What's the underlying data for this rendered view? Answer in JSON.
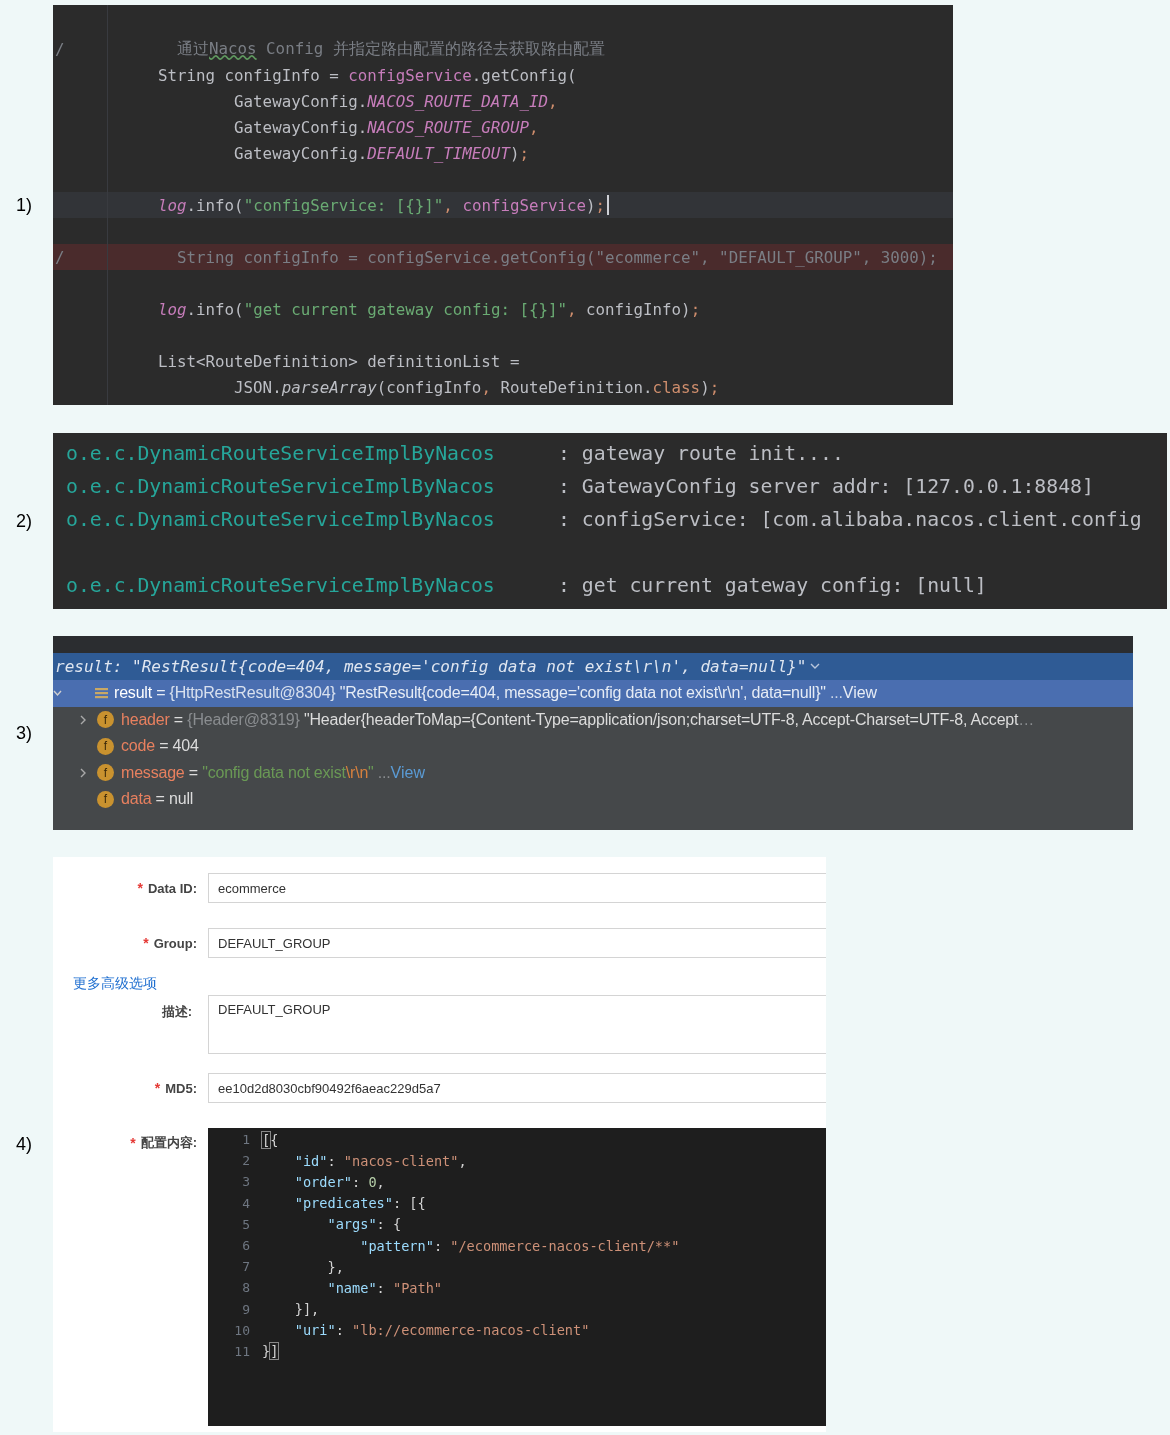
{
  "code": {
    "label": "1)",
    "lines": [
      {
        "kind": "code",
        "gutter": "/",
        "tokens": [
          {
            "kind": "comment",
            "text": "  通过"
          },
          {
            "kind": "typo",
            "text": "Nacos"
          },
          {
            "kind": "comment",
            "text": " Config 并指定路由配置的路径去获取路由配置"
          }
        ]
      },
      {
        "kind": "code",
        "tokens": [
          {
            "kind": "plain",
            "text": "String configInfo = "
          },
          {
            "kind": "field",
            "text": "configService"
          },
          {
            "kind": "plain",
            "text": ".getConfig("
          }
        ]
      },
      {
        "kind": "code",
        "tokens": [
          {
            "kind": "plain",
            "text": "        GatewayConfig."
          },
          {
            "kind": "constant",
            "text": "NACOS_ROUTE_DATA_ID"
          },
          {
            "kind": "punct",
            "text": ","
          }
        ]
      },
      {
        "kind": "code",
        "tokens": [
          {
            "kind": "plain",
            "text": "        GatewayConfig."
          },
          {
            "kind": "constant",
            "text": "NACOS_ROUTE_GROUP"
          },
          {
            "kind": "punct",
            "text": ","
          }
        ]
      },
      {
        "kind": "code",
        "tokens": [
          {
            "kind": "plain",
            "text": "        GatewayConfig."
          },
          {
            "kind": "constant",
            "text": "DEFAULT_TIMEOUT"
          },
          {
            "kind": "plain",
            "text": ")"
          },
          {
            "kind": "punct",
            "text": ";"
          }
        ]
      },
      {
        "kind": "blank"
      },
      {
        "kind": "current",
        "tokens": [
          {
            "kind": "static",
            "text": "log"
          },
          {
            "kind": "plain",
            "text": ".info("
          },
          {
            "kind": "string",
            "text": "\"configService: [{}]\""
          },
          {
            "kind": "punct",
            "text": ", "
          },
          {
            "kind": "field",
            "text": "configService"
          },
          {
            "kind": "plain",
            "text": ")"
          },
          {
            "kind": "punct",
            "text": ";"
          }
        ]
      },
      {
        "kind": "blank"
      },
      {
        "kind": "error",
        "gutter": "/",
        "tokens": [
          {
            "kind": "comment",
            "text": "  String configInfo = configService.getConfig(\"ecommerce\", \"DEFAULT_GROUP\", 3000);"
          }
        ]
      },
      {
        "kind": "blank"
      },
      {
        "kind": "code",
        "tokens": [
          {
            "kind": "static",
            "text": "log"
          },
          {
            "kind": "plain",
            "text": ".info("
          },
          {
            "kind": "string",
            "text": "\"get current gateway config: [{}]\""
          },
          {
            "kind": "punct",
            "text": ", "
          },
          {
            "kind": "plain",
            "text": "configInfo)"
          },
          {
            "kind": "punct",
            "text": ";"
          }
        ]
      },
      {
        "kind": "blank"
      },
      {
        "kind": "code",
        "tokens": [
          {
            "kind": "plain",
            "text": "List<RouteDefinition> definitionList ="
          }
        ]
      },
      {
        "kind": "code",
        "tokens": [
          {
            "kind": "plain",
            "text": "        JSON."
          },
          {
            "kind": "italic",
            "text": "parseArray"
          },
          {
            "kind": "plain",
            "text": "(configInfo"
          },
          {
            "kind": "punct",
            "text": ", "
          },
          {
            "kind": "plain",
            "text": "RouteDefinition."
          },
          {
            "kind": "punct",
            "text": "class"
          },
          {
            "kind": "plain",
            "text": ")"
          },
          {
            "kind": "punct",
            "text": ";"
          }
        ]
      }
    ]
  },
  "console": {
    "label": "2)",
    "lines": [
      {
        "kind": "log",
        "logger": "o.e.c.DynamicRouteServiceImplByNacos",
        "message": ": gateway route init...."
      },
      {
        "kind": "log",
        "logger": "o.e.c.DynamicRouteServiceImplByNacos",
        "message": ": GatewayConfig server addr: [127.0.0.1:8848]"
      },
      {
        "kind": "log",
        "logger": "o.e.c.DynamicRouteServiceImplByNacos",
        "message": ": configService: [com.alibaba.nacos.client.config"
      },
      {
        "kind": "blank"
      },
      {
        "kind": "log",
        "logger": "o.e.c.DynamicRouteServiceImplByNacos",
        "message": ": get current gateway config: [null]"
      }
    ]
  },
  "debugger": {
    "label": "3)",
    "eval": "result: \"RestResult{code=404, message='config data not exist\\r\\n', data=null}\"",
    "tree": [
      {
        "kind": "list",
        "selected": true,
        "expanded": true,
        "tokens": [
          {
            "kind": "name",
            "text": "result"
          },
          {
            "kind": "plain",
            "text": " = "
          },
          {
            "kind": "ref",
            "text": "{HttpRestResult@8304}"
          },
          {
            "kind": "plain",
            "text": " \"RestResult{code=404, message='config data not exist\\r\\n', data=null}\""
          },
          {
            "kind": "dim",
            "text": " ..."
          }
        ],
        "link": "View",
        "children": [
          {
            "kind": "field",
            "badge": "f",
            "selected": false,
            "expanded": false,
            "tokens": [
              {
                "kind": "name",
                "text": "header"
              },
              {
                "kind": "plain",
                "text": " = "
              },
              {
                "kind": "ref",
                "text": "{Header@8319}"
              },
              {
                "kind": "plain",
                "text": " \"Header{headerToMap={Content-Type=application/json;charset=UTF-8, Accept-Charset=UTF-8, Accept"
              },
              {
                "kind": "dim",
                "text": "…"
              }
            ]
          },
          {
            "kind": "field",
            "badge": "f",
            "selected": false,
            "tokens": [
              {
                "kind": "name",
                "text": "code"
              },
              {
                "kind": "plain",
                "text": " = 404"
              }
            ]
          },
          {
            "kind": "field",
            "badge": "f",
            "selected": false,
            "expanded": false,
            "tokens": [
              {
                "kind": "name",
                "text": "message"
              },
              {
                "kind": "plain",
                "text": " = "
              },
              {
                "kind": "string",
                "text": "\"config data not exist"
              },
              {
                "kind": "escape",
                "text": "\\r\\n"
              },
              {
                "kind": "string",
                "text": "\""
              },
              {
                "kind": "dim",
                "text": " ..."
              }
            ],
            "link": "View"
          },
          {
            "kind": "field",
            "badge": "f",
            "selected": false,
            "tokens": [
              {
                "kind": "name",
                "text": "data"
              },
              {
                "kind": "plain",
                "text": " = null"
              }
            ]
          }
        ]
      }
    ]
  },
  "form": {
    "label": "4)",
    "items": [
      {
        "kind": "input",
        "mark": "*",
        "label": "Data ID:",
        "value": "ecommerce"
      },
      {
        "kind": "input",
        "mark": "*",
        "label": "Group:",
        "value": "DEFAULT_GROUP"
      },
      {
        "kind": "link",
        "text": "更多高级选项"
      },
      {
        "kind": "textarea",
        "label": "描述:",
        "value": "DEFAULT_GROUP"
      },
      {
        "kind": "input",
        "mark": "*",
        "label": "MD5:",
        "value": "ee10d2d8030cbf90492f6aeac229d5a7"
      },
      {
        "kind": "editor",
        "mark": "*",
        "label": "配置内容:",
        "lines": [
          {
            "number": "1",
            "tokens": [
              {
                "kind": "match",
                "text": "["
              },
              {
                "kind": "punct",
                "text": "{"
              }
            ]
          },
          {
            "number": "2",
            "tokens": [
              {
                "kind": "key",
                "text": "    \"id\""
              },
              {
                "kind": "punct",
                "text": ": "
              },
              {
                "kind": "string",
                "text": "\"nacos-client\""
              },
              {
                "kind": "punct",
                "text": ","
              }
            ]
          },
          {
            "number": "3",
            "tokens": [
              {
                "kind": "key",
                "text": "    \"order\""
              },
              {
                "kind": "punct",
                "text": ": "
              },
              {
                "kind": "number",
                "text": "0"
              },
              {
                "kind": "punct",
                "text": ","
              }
            ]
          },
          {
            "number": "4",
            "tokens": [
              {
                "kind": "key",
                "text": "    \"predicates\""
              },
              {
                "kind": "punct",
                "text": ": [{"
              }
            ]
          },
          {
            "number": "5",
            "tokens": [
              {
                "kind": "key",
                "text": "        \"args\""
              },
              {
                "kind": "punct",
                "text": ": {"
              }
            ]
          },
          {
            "number": "6",
            "tokens": [
              {
                "kind": "key",
                "text": "            \"pattern\""
              },
              {
                "kind": "punct",
                "text": ": "
              },
              {
                "kind": "string",
                "text": "\"/ecommerce-nacos-client/**\""
              }
            ]
          },
          {
            "number": "7",
            "tokens": [
              {
                "kind": "punct",
                "text": "        },"
              }
            ]
          },
          {
            "number": "8",
            "tokens": [
              {
                "kind": "key",
                "text": "        \"name\""
              },
              {
                "kind": "punct",
                "text": ": "
              },
              {
                "kind": "string",
                "text": "\"Path\""
              }
            ]
          },
          {
            "number": "9",
            "tokens": [
              {
                "kind": "punct",
                "text": "    }],"
              }
            ]
          },
          {
            "number": "10",
            "tokens": [
              {
                "kind": "key",
                "text": "    \"uri\""
              },
              {
                "kind": "punct",
                "text": ": "
              },
              {
                "kind": "string",
                "text": "\"lb://ecommerce-nacos-client\""
              }
            ]
          },
          {
            "number": "11",
            "tokens": [
              {
                "kind": "punct",
                "text": "}"
              },
              {
                "kind": "match",
                "text": "]"
              }
            ]
          }
        ]
      }
    ]
  }
}
